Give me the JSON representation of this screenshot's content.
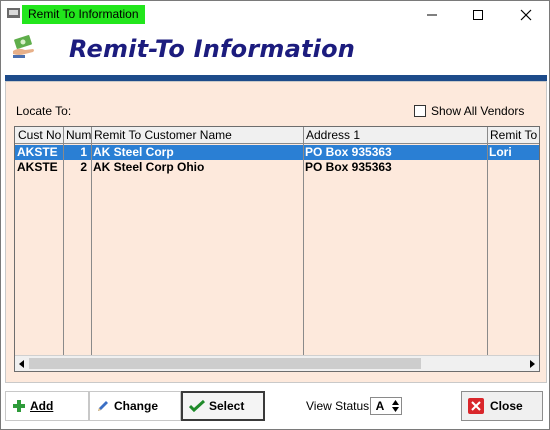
{
  "window": {
    "title": "Remit To Information"
  },
  "header": {
    "title": "Remit-To Information"
  },
  "filter": {
    "locate_label": "Locate To:",
    "show_all_label": "Show All Vendors",
    "show_all_checked": false
  },
  "grid": {
    "columns": [
      "Cust No",
      "Num",
      "Remit To Customer Name",
      "Address 1",
      "Remit To"
    ],
    "rows": [
      {
        "cust_no": "AKSTE",
        "num": "1",
        "name": "AK Steel Corp",
        "address1": "PO Box 935363",
        "remit_to": "Lori",
        "selected": true
      },
      {
        "cust_no": "AKSTE",
        "num": "2",
        "name": "AK Steel Corp Ohio",
        "address1": "PO Box 935363",
        "remit_to": "",
        "selected": false
      }
    ]
  },
  "toolbar": {
    "add_label": "Add",
    "change_label": "Change",
    "select_label": "Select",
    "close_label": "Close",
    "view_status_label": "View Status:",
    "view_status_value": "A"
  },
  "colors": {
    "title_highlight": "#22e61c",
    "header_text": "#1c1c7e",
    "header_bar": "#1d4b8a",
    "panel_bg": "#fde9dc",
    "selected_row": "#2a7fd4"
  },
  "icons": {
    "app": "app-icon",
    "header": "money-hand-icon",
    "minimize": "minimize-icon",
    "maximize": "maximize-icon",
    "close": "close-icon",
    "add": "plus-icon",
    "change": "pencil-icon",
    "select": "checkmark-icon",
    "close_button": "close-x-icon"
  }
}
